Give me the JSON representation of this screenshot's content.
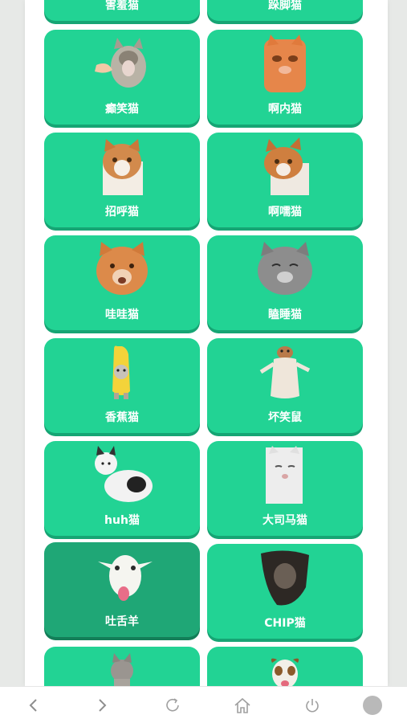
{
  "cards": [
    {
      "label": "害羞猫",
      "icon": "cat-sticker-icon"
    },
    {
      "label": "跺脚猫",
      "icon": "cat-sticker-icon"
    },
    {
      "label": "癫笑猫",
      "icon": "laughing-cat-icon"
    },
    {
      "label": "啊内猫",
      "icon": "orange-cat-icon"
    },
    {
      "label": "招呼猫",
      "icon": "tabby-cat-icon"
    },
    {
      "label": "啊嚅猫",
      "icon": "tabby-cat-icon"
    },
    {
      "label": "哇哇猫",
      "icon": "orange-cat-icon"
    },
    {
      "label": "瞌睡猫",
      "icon": "grey-cat-icon"
    },
    {
      "label": "香蕉猫",
      "icon": "banana-cat-icon"
    },
    {
      "label": "坏笑鼠",
      "icon": "capybara-icon"
    },
    {
      "label": "huh猫",
      "icon": "white-cat-icon"
    },
    {
      "label": "大司马猫",
      "icon": "white-cat-icon"
    },
    {
      "label": "吐舌羊",
      "icon": "goat-icon"
    },
    {
      "label": "CHIP猫",
      "icon": "dark-cat-icon"
    },
    {
      "label": "",
      "icon": "grey-cat-icon"
    },
    {
      "label": "",
      "icon": "dog-icon"
    }
  ],
  "colors": {
    "card": "#22d394",
    "card_shadow": "#16a574",
    "card_pressed": "#1fa776",
    "page_bg": "#ffffff",
    "outer_bg": "#e7e9e7"
  },
  "nav": [
    "back-icon",
    "forward-icon",
    "reload-icon",
    "home-icon",
    "power-icon",
    "circle-icon"
  ]
}
